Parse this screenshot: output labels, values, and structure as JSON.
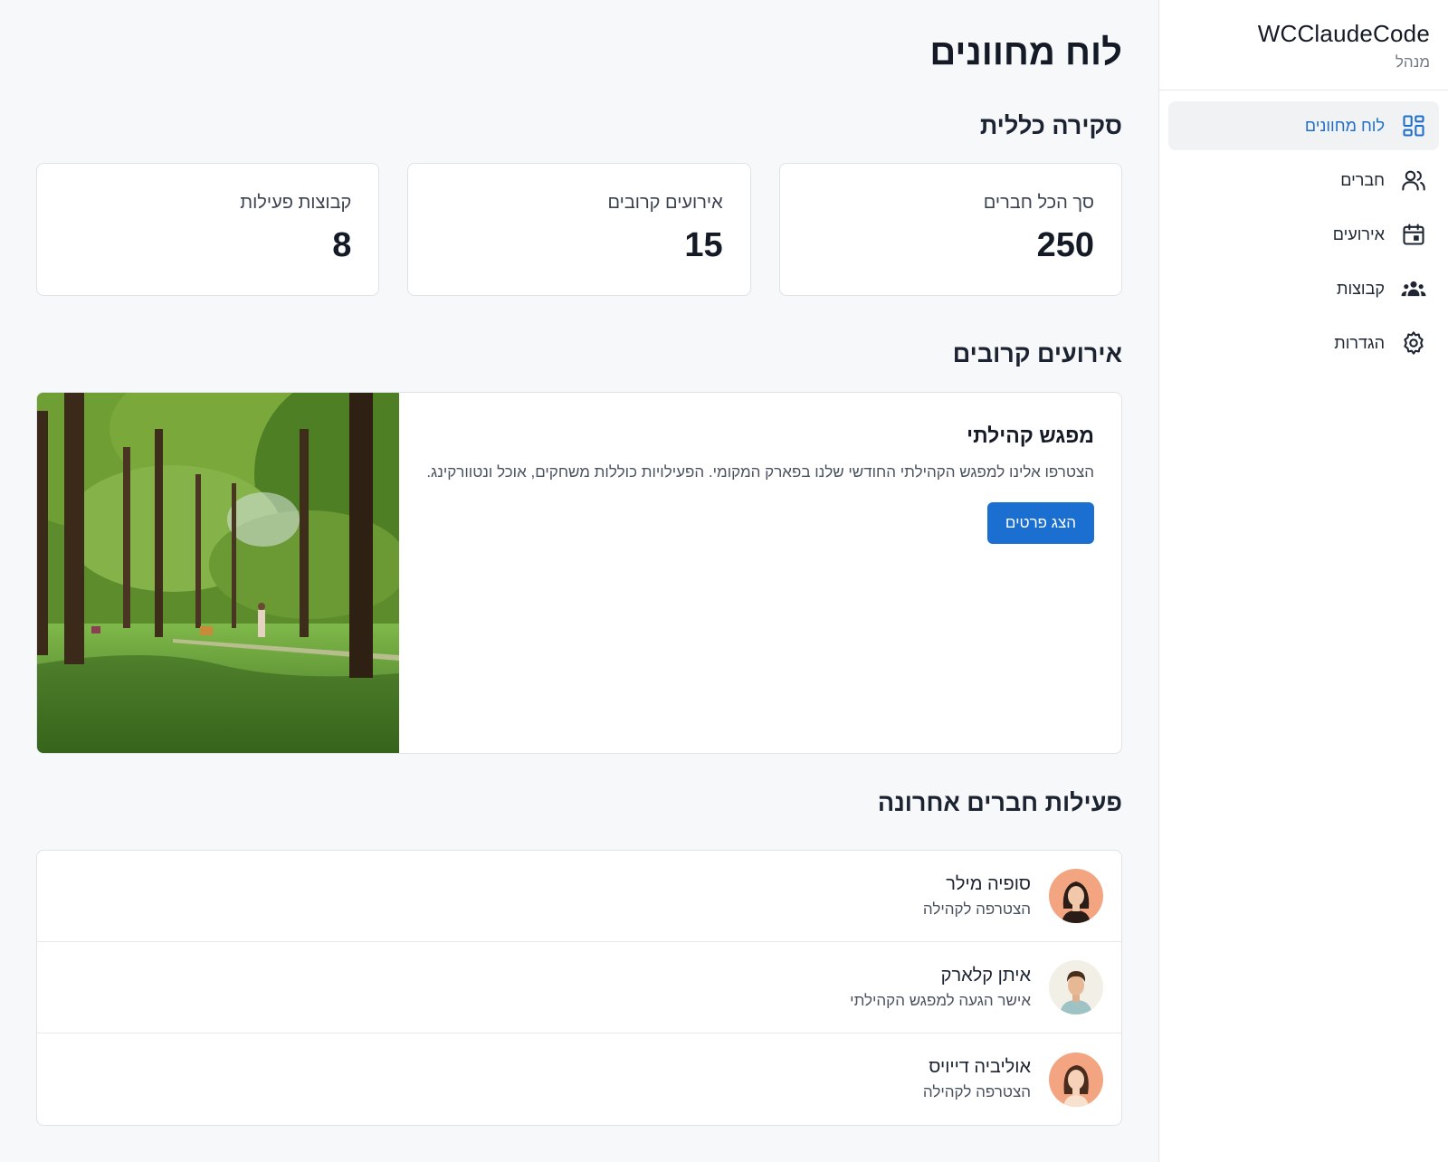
{
  "app": {
    "name": "WCClaudeCode",
    "role": "מנהל"
  },
  "nav": [
    {
      "label": "לוח מחוונים",
      "icon": "dashboard-icon",
      "active": true
    },
    {
      "label": "חברים",
      "icon": "users-icon",
      "active": false
    },
    {
      "label": "אירועים",
      "icon": "calendar-icon",
      "active": false
    },
    {
      "label": "קבוצות",
      "icon": "groups-icon",
      "active": false
    },
    {
      "label": "הגדרות",
      "icon": "gear-icon",
      "active": false
    }
  ],
  "page": {
    "title": "לוח מחוונים"
  },
  "overview": {
    "title": "סקירה כללית",
    "stats": [
      {
        "label": "סך הכל חברים",
        "value": "250"
      },
      {
        "label": "אירועים קרובים",
        "value": "15"
      },
      {
        "label": "קבוצות פעילות",
        "value": "8"
      }
    ]
  },
  "events": {
    "title": "אירועים קרובים",
    "items": [
      {
        "title": "מפגש קהילתי",
        "description": "הצטרפו אלינו למפגש הקהילתי החודשי שלנו בפארק המקומי. הפעילויות כוללות משחקים, אוכל ונטוורקינג.",
        "button_label": "הצג פרטים",
        "image": "park-photo"
      }
    ]
  },
  "activity": {
    "title": "פעילות חברים אחרונה",
    "items": [
      {
        "name": "סופיה מילר",
        "action": "הצטרפה לקהילה",
        "avatar": "woman-avatar"
      },
      {
        "name": "איתן קלארק",
        "action": "אישר הגעה למפגש הקהילתי",
        "avatar": "man-avatar"
      },
      {
        "name": "אוליביה דייויס",
        "action": "הצטרפה לקהילה",
        "avatar": "woman-avatar"
      }
    ]
  },
  "colors": {
    "accent": "#1a6fd0",
    "background": "#f7f8fa",
    "card": "#ffffff",
    "border": "#dfe2e7"
  }
}
